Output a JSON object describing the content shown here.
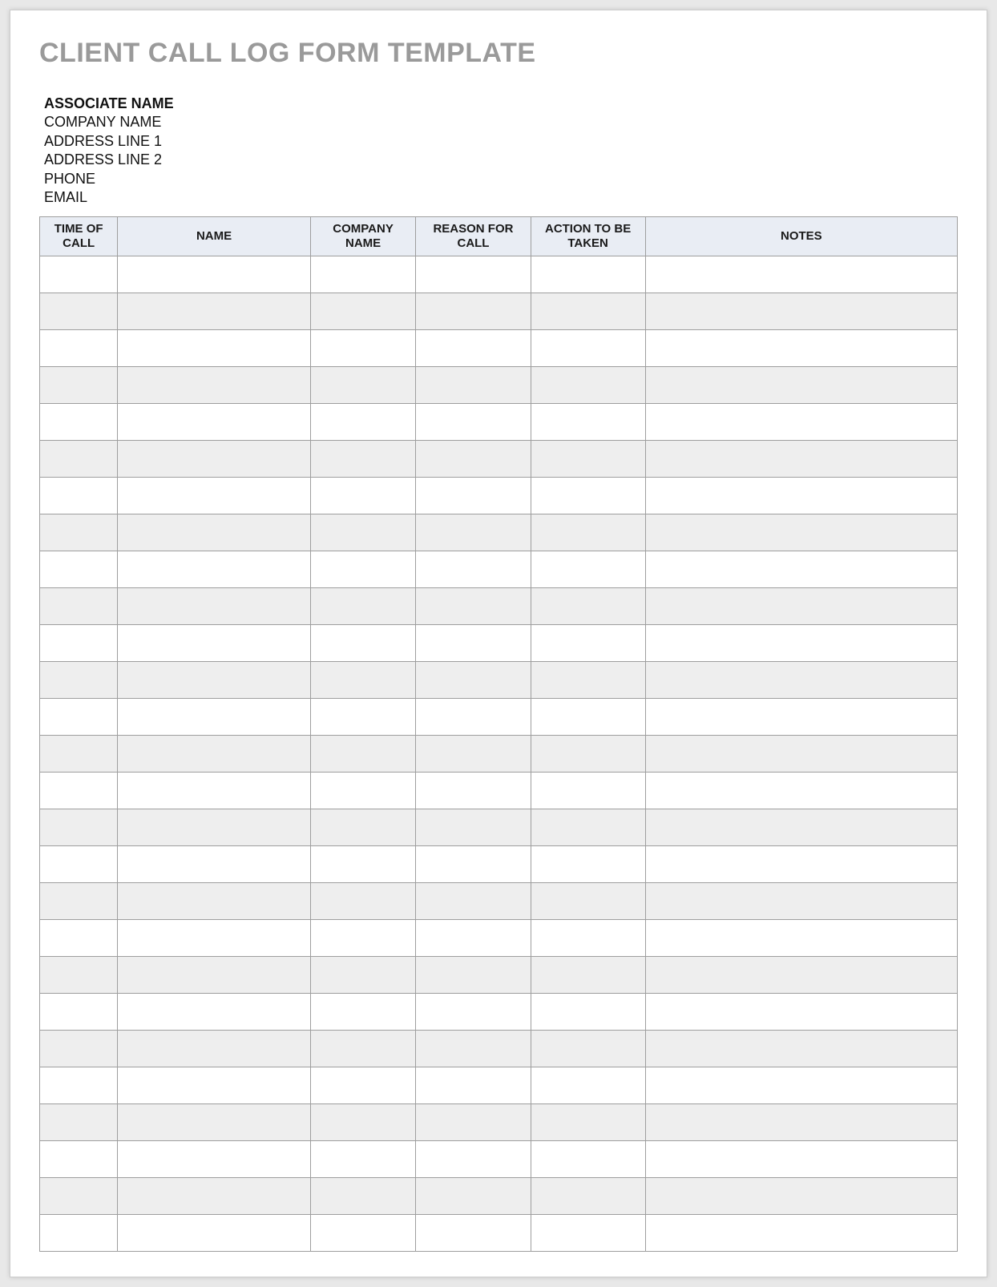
{
  "title": "CLIENT CALL LOG FORM TEMPLATE",
  "header": {
    "associate_label": "ASSOCIATE NAME",
    "company_label": "COMPANY NAME",
    "address1_label": "ADDRESS LINE 1",
    "address2_label": "ADDRESS LINE 2",
    "phone_label": "PHONE",
    "email_label": "EMAIL"
  },
  "columns": {
    "time_of_call": "TIME OF CALL",
    "name": "NAME",
    "company_name": "COMPANY NAME",
    "reason_for_call": "REASON FOR CALL",
    "action_to_be_taken": "ACTION TO BE TAKEN",
    "notes": "NOTES"
  },
  "rows": [
    {
      "time": "",
      "name": "",
      "company": "",
      "reason": "",
      "action": "",
      "notes": ""
    },
    {
      "time": "",
      "name": "",
      "company": "",
      "reason": "",
      "action": "",
      "notes": ""
    },
    {
      "time": "",
      "name": "",
      "company": "",
      "reason": "",
      "action": "",
      "notes": ""
    },
    {
      "time": "",
      "name": "",
      "company": "",
      "reason": "",
      "action": "",
      "notes": ""
    },
    {
      "time": "",
      "name": "",
      "company": "",
      "reason": "",
      "action": "",
      "notes": ""
    },
    {
      "time": "",
      "name": "",
      "company": "",
      "reason": "",
      "action": "",
      "notes": ""
    },
    {
      "time": "",
      "name": "",
      "company": "",
      "reason": "",
      "action": "",
      "notes": ""
    },
    {
      "time": "",
      "name": "",
      "company": "",
      "reason": "",
      "action": "",
      "notes": ""
    },
    {
      "time": "",
      "name": "",
      "company": "",
      "reason": "",
      "action": "",
      "notes": ""
    },
    {
      "time": "",
      "name": "",
      "company": "",
      "reason": "",
      "action": "",
      "notes": ""
    },
    {
      "time": "",
      "name": "",
      "company": "",
      "reason": "",
      "action": "",
      "notes": ""
    },
    {
      "time": "",
      "name": "",
      "company": "",
      "reason": "",
      "action": "",
      "notes": ""
    },
    {
      "time": "",
      "name": "",
      "company": "",
      "reason": "",
      "action": "",
      "notes": ""
    },
    {
      "time": "",
      "name": "",
      "company": "",
      "reason": "",
      "action": "",
      "notes": ""
    },
    {
      "time": "",
      "name": "",
      "company": "",
      "reason": "",
      "action": "",
      "notes": ""
    },
    {
      "time": "",
      "name": "",
      "company": "",
      "reason": "",
      "action": "",
      "notes": ""
    },
    {
      "time": "",
      "name": "",
      "company": "",
      "reason": "",
      "action": "",
      "notes": ""
    },
    {
      "time": "",
      "name": "",
      "company": "",
      "reason": "",
      "action": "",
      "notes": ""
    },
    {
      "time": "",
      "name": "",
      "company": "",
      "reason": "",
      "action": "",
      "notes": ""
    },
    {
      "time": "",
      "name": "",
      "company": "",
      "reason": "",
      "action": "",
      "notes": ""
    },
    {
      "time": "",
      "name": "",
      "company": "",
      "reason": "",
      "action": "",
      "notes": ""
    },
    {
      "time": "",
      "name": "",
      "company": "",
      "reason": "",
      "action": "",
      "notes": ""
    },
    {
      "time": "",
      "name": "",
      "company": "",
      "reason": "",
      "action": "",
      "notes": ""
    },
    {
      "time": "",
      "name": "",
      "company": "",
      "reason": "",
      "action": "",
      "notes": ""
    },
    {
      "time": "",
      "name": "",
      "company": "",
      "reason": "",
      "action": "",
      "notes": ""
    },
    {
      "time": "",
      "name": "",
      "company": "",
      "reason": "",
      "action": "",
      "notes": ""
    },
    {
      "time": "",
      "name": "",
      "company": "",
      "reason": "",
      "action": "",
      "notes": ""
    }
  ]
}
